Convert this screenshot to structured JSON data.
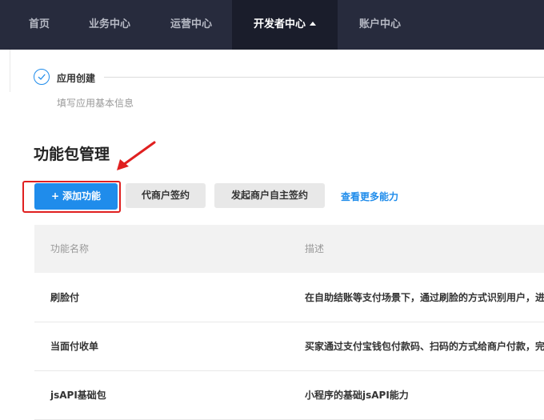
{
  "nav": {
    "items": [
      {
        "label": "首页"
      },
      {
        "label": "业务中心"
      },
      {
        "label": "运营中心"
      },
      {
        "label": "开发者中心"
      },
      {
        "label": "账户中心"
      }
    ]
  },
  "step": {
    "title": "应用创建",
    "description": "填写应用基本信息"
  },
  "section": {
    "title": "功能包管理"
  },
  "actions": {
    "add_plus": "+",
    "add_label": "添加功能",
    "agent_sign_label": "代商户签约",
    "self_sign_label": "发起商户自主签约",
    "more_link": "查看更多能力"
  },
  "table": {
    "headers": {
      "name": "功能名称",
      "description": "描述"
    },
    "rows": [
      {
        "name": "刷脸付",
        "description": "在自助结账等支付场景下，通过刷脸的方式识别用户，进"
      },
      {
        "name": "当面付收单",
        "description": "买家通过支付宝钱包付款码、扫码的方式给商户付款，完"
      },
      {
        "name": "jsAPI基础包",
        "description": "小程序的基础jsAPI能力"
      }
    ]
  },
  "colors": {
    "nav_bg": "#272b3d",
    "nav_active_bg": "#1a1d2b",
    "primary": "#1f8ceb",
    "highlight": "#e02020"
  }
}
